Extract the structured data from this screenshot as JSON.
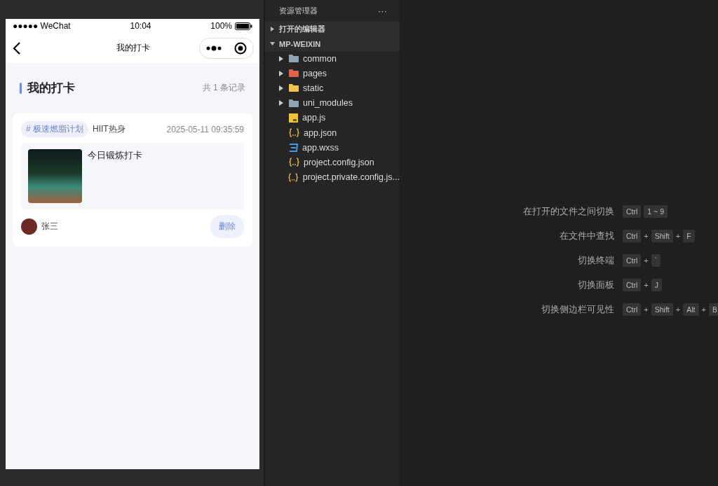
{
  "phone": {
    "status_bar": {
      "carrier": "●●●●● WeChat",
      "time": "10:04",
      "battery": "100%"
    },
    "nav": {
      "title": "我的打卡"
    },
    "header": {
      "title": "我的打卡",
      "count": "共 1 条记录"
    },
    "records": [
      {
        "tag": "# 极速燃脂计划",
        "category": "HIIT热身",
        "time": "2025-05-11 09:35:59",
        "text": "今日锻炼打卡",
        "user": "张三",
        "delete": "删除"
      }
    ]
  },
  "explorer": {
    "title": "资源管理器",
    "more": "···",
    "sections": [
      {
        "label": "打开的编辑器",
        "expanded": false
      },
      {
        "label": "MP-WEIXIN",
        "expanded": true,
        "items": [
          {
            "name": "common",
            "kind": "folder",
            "expanded": false
          },
          {
            "name": "pages",
            "kind": "pages",
            "expanded": false
          },
          {
            "name": "static",
            "kind": "static",
            "expanded": false
          },
          {
            "name": "uni_modules",
            "kind": "folder",
            "expanded": false
          },
          {
            "name": "app.js",
            "kind": "js"
          },
          {
            "name": "app.json",
            "kind": "json"
          },
          {
            "name": "app.wxss",
            "kind": "css"
          },
          {
            "name": "project.config.json",
            "kind": "json"
          },
          {
            "name": "project.private.config.js...",
            "kind": "json"
          }
        ]
      }
    ]
  },
  "shortcuts": [
    {
      "label": "在打开的文件之间切换",
      "keys": [
        {
          "kind": "key",
          "text": "Ctrl"
        },
        {
          "kind": "key",
          "text": "1 ~ 9"
        }
      ]
    },
    {
      "label": "在文件中查找",
      "keys": [
        {
          "kind": "key",
          "text": "Ctrl"
        },
        {
          "kind": "plus",
          "text": "+"
        },
        {
          "kind": "key",
          "text": "Shift"
        },
        {
          "kind": "plus",
          "text": "+"
        },
        {
          "kind": "key",
          "text": "F"
        }
      ]
    },
    {
      "label": "切换终端",
      "keys": [
        {
          "kind": "key",
          "text": "Ctrl"
        },
        {
          "kind": "plus",
          "text": "+"
        },
        {
          "kind": "key",
          "text": "`"
        }
      ]
    },
    {
      "label": "切换面板",
      "keys": [
        {
          "kind": "key",
          "text": "Ctrl"
        },
        {
          "kind": "plus",
          "text": "+"
        },
        {
          "kind": "key",
          "text": "J"
        }
      ]
    },
    {
      "label": "切换侧边栏可见性",
      "keys": [
        {
          "kind": "key",
          "text": "Ctrl"
        },
        {
          "kind": "plus",
          "text": "+"
        },
        {
          "kind": "key",
          "text": "Shift"
        },
        {
          "kind": "plus",
          "text": "+"
        },
        {
          "kind": "key",
          "text": "Alt"
        },
        {
          "kind": "plus",
          "text": "+"
        },
        {
          "kind": "key",
          "text": "B"
        }
      ]
    }
  ]
}
